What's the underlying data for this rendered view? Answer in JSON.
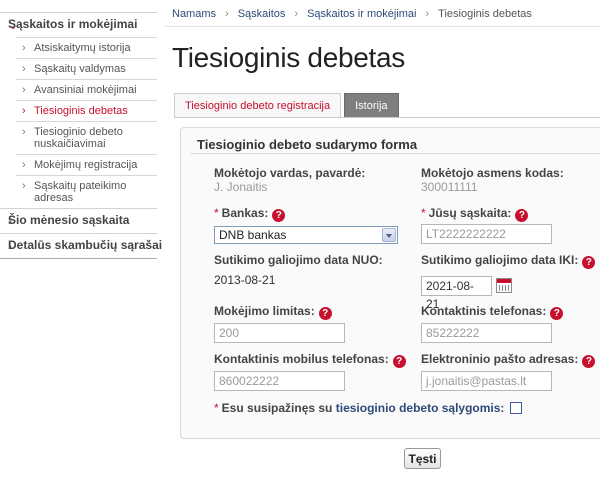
{
  "sidebar": {
    "sections": [
      {
        "label": "Sąskaitos ir mokėjimai",
        "expanded": true
      },
      {
        "label": "Šio mėnesio sąskaita",
        "expanded": false
      },
      {
        "label": "Detalūs skambučių sąrašai",
        "expanded": false
      }
    ],
    "sub_items": [
      {
        "label": "Atsiskaitymų istorija"
      },
      {
        "label": "Sąskaitų valdymas"
      },
      {
        "label": "Avansiniai mokėjimai"
      },
      {
        "label": "Tiesioginis debetas",
        "active": true
      },
      {
        "label": "Tiesioginio debeto nuskaičiavimai"
      },
      {
        "label": "Mokėjimų registracija"
      },
      {
        "label": "Sąskaitų pateikimo adresas"
      }
    ]
  },
  "breadcrumb": [
    "Namams",
    "Sąskaitos",
    "Sąskaitos ir mokėjimai",
    "Tiesioginis debetas"
  ],
  "page_title": "Tiesioginis debetas",
  "tabs": [
    {
      "label": "Tiesioginio debeto registracija",
      "active": true
    },
    {
      "label": "Istorija",
      "active": false
    }
  ],
  "form": {
    "title": "Tiesioginio debeto sudarymo forma",
    "payer_name_label": "Mokėtojo vardas, pavardė:",
    "payer_name_value": "J. Jonaitis",
    "payer_code_label": "Mokėtojo asmens kodas:",
    "payer_code_value": "300011111",
    "required_mark": "*",
    "bank_label": "Bankas:",
    "bank_value": "DNB bankas",
    "account_label": "Jūsų sąskaita:",
    "account_value": "LT2222222222",
    "valid_from_label": "Sutikimo galiojimo data NUO:",
    "valid_from_value": "2013-08-21",
    "valid_to_label": "Sutikimo galiojimo data IKI:",
    "valid_to_value": "2021-08-21",
    "limit_label": "Mokėjimo limitas:",
    "limit_value": "200",
    "phone_label": "Kontaktinis telefonas:",
    "phone_value": "85222222",
    "mobile_label": "Kontaktinis mobilus telefonas:",
    "mobile_value": "860022222",
    "email_label": "Elektroninio pašto adresas:",
    "email_value": "j.jonaitis@pastas.lt",
    "agree_prefix": "Esu susipažinęs su",
    "agree_link": "tiesioginio debeto sąlygomis:",
    "agree_checked": false,
    "help_symbol": "?"
  },
  "submit_label": "Tęsti",
  "colors": {
    "accent": "#c8102e",
    "link": "#2e4a78",
    "tab_inactive": "#7e7e7e"
  }
}
